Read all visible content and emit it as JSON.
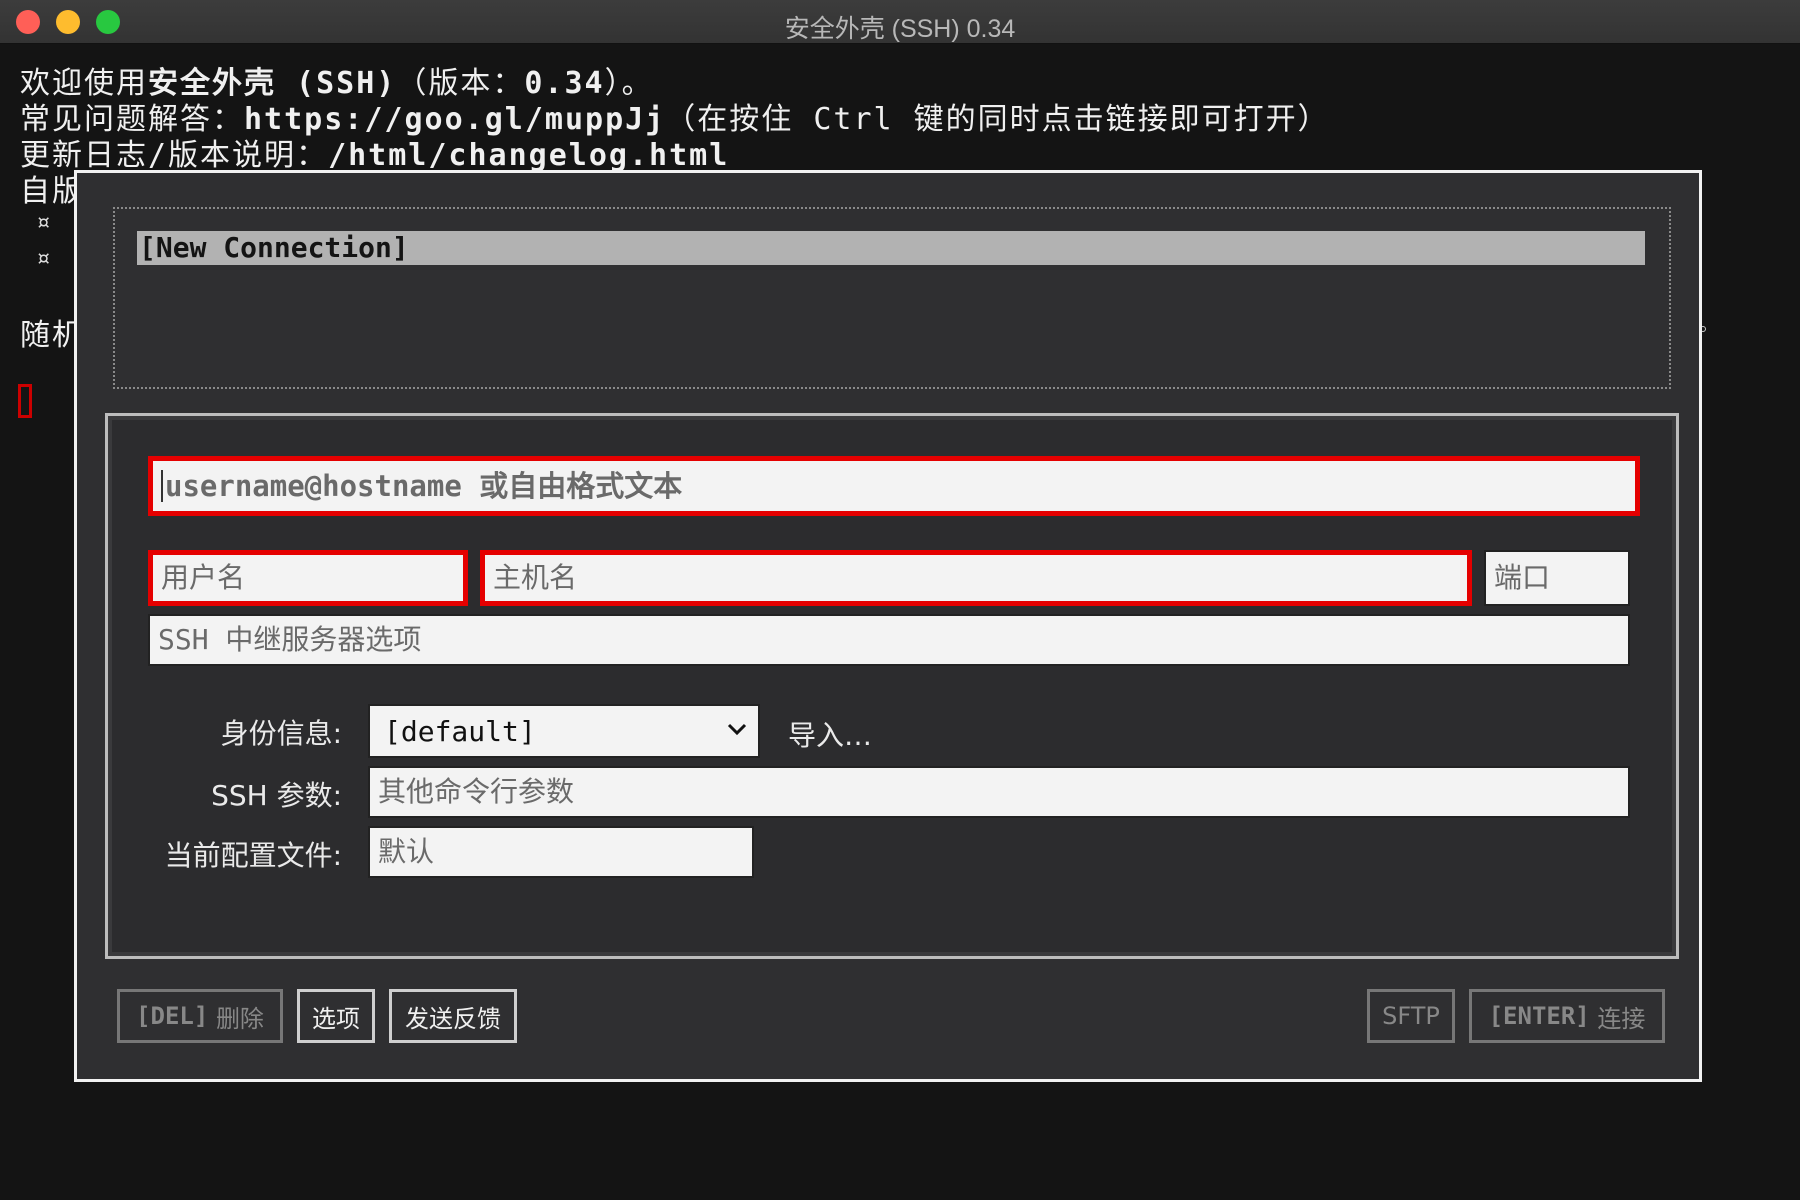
{
  "window": {
    "title": "安全外壳 (SSH) 0.34"
  },
  "terminal": {
    "line1_prefix": "欢迎使用",
    "line1_app": "安全外壳 (SSH)",
    "line1_suffix": "（版本：",
    "line1_version": "0.34",
    "line1_end": "）。",
    "line2_label": "常见问题解答：",
    "line2_url": "https://goo.gl/muppJj",
    "line2_note": "（在按住 Ctrl 键的同时点击链接即可打开）",
    "line3_label": "更新日志/版本说明：",
    "line3_path": "/html/changelog.html",
    "line4_partial": "自版",
    "bullet_glyph": "¤",
    "line5_partial": "随机"
  },
  "connections": {
    "items": [
      "[New Connection]"
    ]
  },
  "form": {
    "quick_placeholder": "username@hostname 或自由格式文本",
    "username_placeholder": "用户名",
    "hostname_placeholder": "主机名",
    "port_placeholder": "端口",
    "relay_placeholder": "SSH 中继服务器选项",
    "identity_label": "身份信息:",
    "identity_value": "[default]",
    "import_label": "导入…",
    "args_label": "SSH 参数:",
    "args_placeholder": "其他命令行参数",
    "profile_label": "当前配置文件:",
    "profile_placeholder": "默认"
  },
  "buttons": {
    "delete_key": "[DEL]",
    "delete_label": "删除",
    "options_label": "选项",
    "feedback_label": "发送反馈",
    "sftp_label": "SFTP",
    "connect_key": "[ENTER]",
    "connect_label": "连接"
  },
  "colors": {
    "error_border": "#e50000",
    "terminal_bg": "#141414",
    "dialog_bg": "#2f2f31",
    "selected_item_bg": "#b2b2b2"
  }
}
